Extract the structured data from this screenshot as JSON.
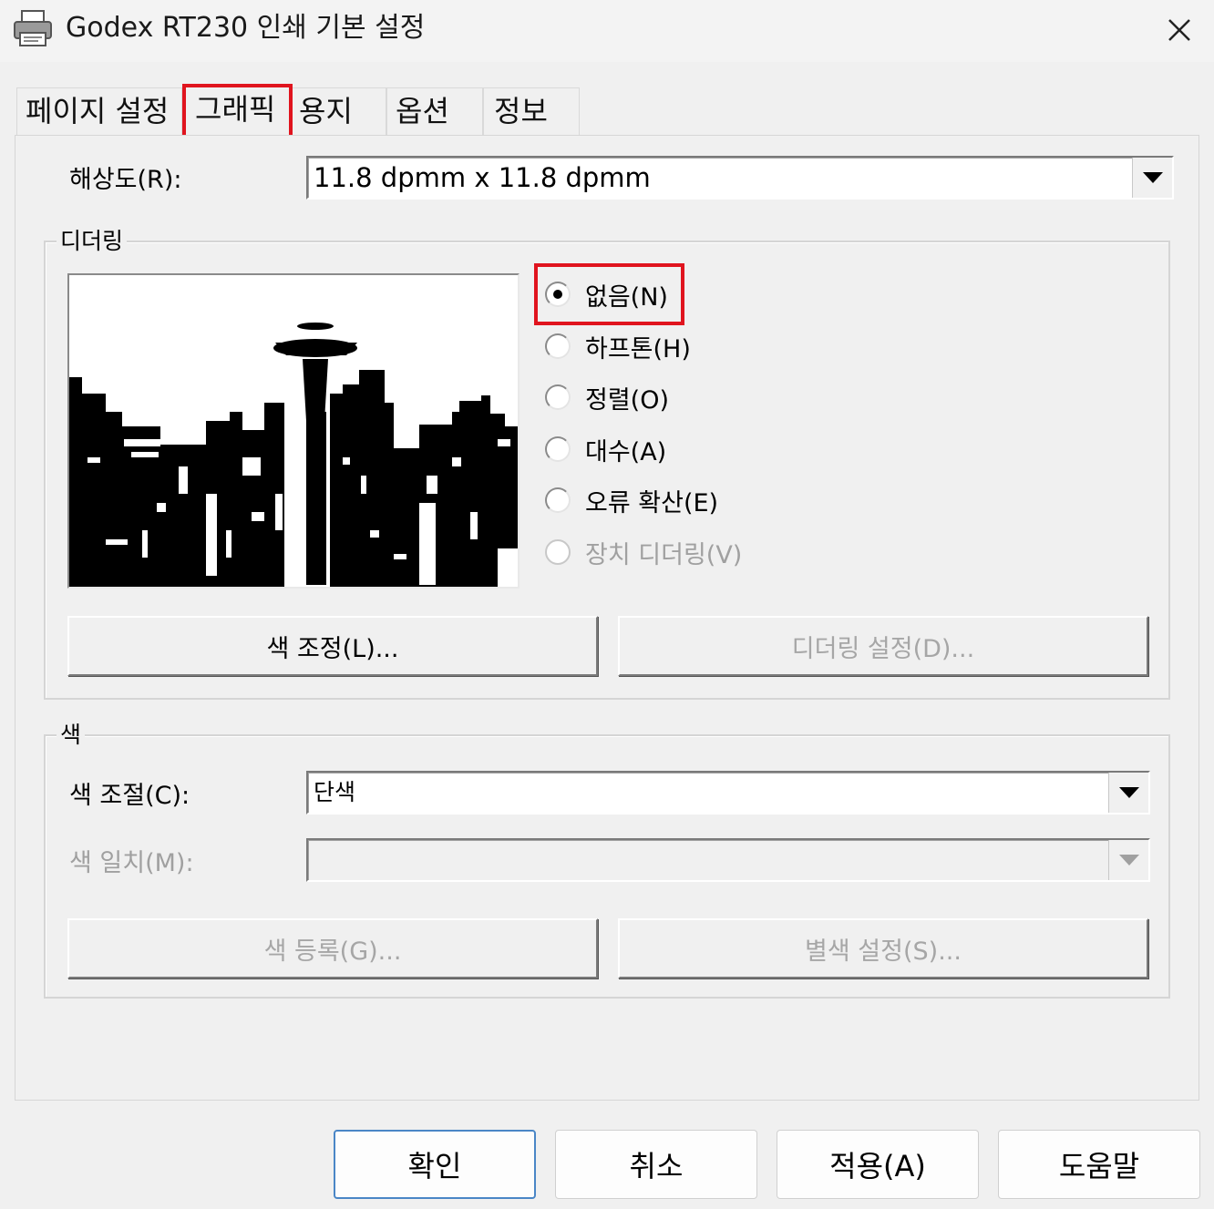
{
  "window": {
    "title": "Godex RT230 인쇄 기본 설정",
    "close_icon": "close-icon",
    "app_icon": "printer-icon"
  },
  "tabs": [
    {
      "label": "페이지 설정",
      "selected": false
    },
    {
      "label": "그래픽",
      "selected": true
    },
    {
      "label": "용지",
      "selected": false
    },
    {
      "label": "옵션",
      "selected": false
    },
    {
      "label": "정보",
      "selected": false
    }
  ],
  "resolution": {
    "label": "해상도(R):",
    "value": "11.8 dpmm x 11.8 dpmm"
  },
  "dithering": {
    "group_title": "디더링",
    "options": [
      {
        "label": "없음(N)",
        "checked": true,
        "enabled": true
      },
      {
        "label": "하프톤(H)",
        "checked": false,
        "enabled": true
      },
      {
        "label": "정렬(O)",
        "checked": false,
        "enabled": true
      },
      {
        "label": "대수(A)",
        "checked": false,
        "enabled": true
      },
      {
        "label": "오류 확산(E)",
        "checked": false,
        "enabled": true
      },
      {
        "label": "장치 디더링(V)",
        "checked": false,
        "enabled": false
      }
    ],
    "color_adjust_button": "색 조정(L)...",
    "dither_settings_button": "디더링 설정(D)..."
  },
  "color": {
    "group_title": "색",
    "color_control_label": "색 조절(C):",
    "color_control_value": "단색",
    "color_match_label": "색 일치(M):",
    "color_match_value": "",
    "register_color_button": "색 등록(G)...",
    "spot_color_button": "별색 설정(S)..."
  },
  "footer": {
    "ok": "확인",
    "cancel": "취소",
    "apply": "적용(A)",
    "help": "도움말"
  },
  "colors": {
    "highlight_red": "#e0141e",
    "default_button_border": "#4a86c6",
    "disabled_text": "#a0a0a0"
  }
}
